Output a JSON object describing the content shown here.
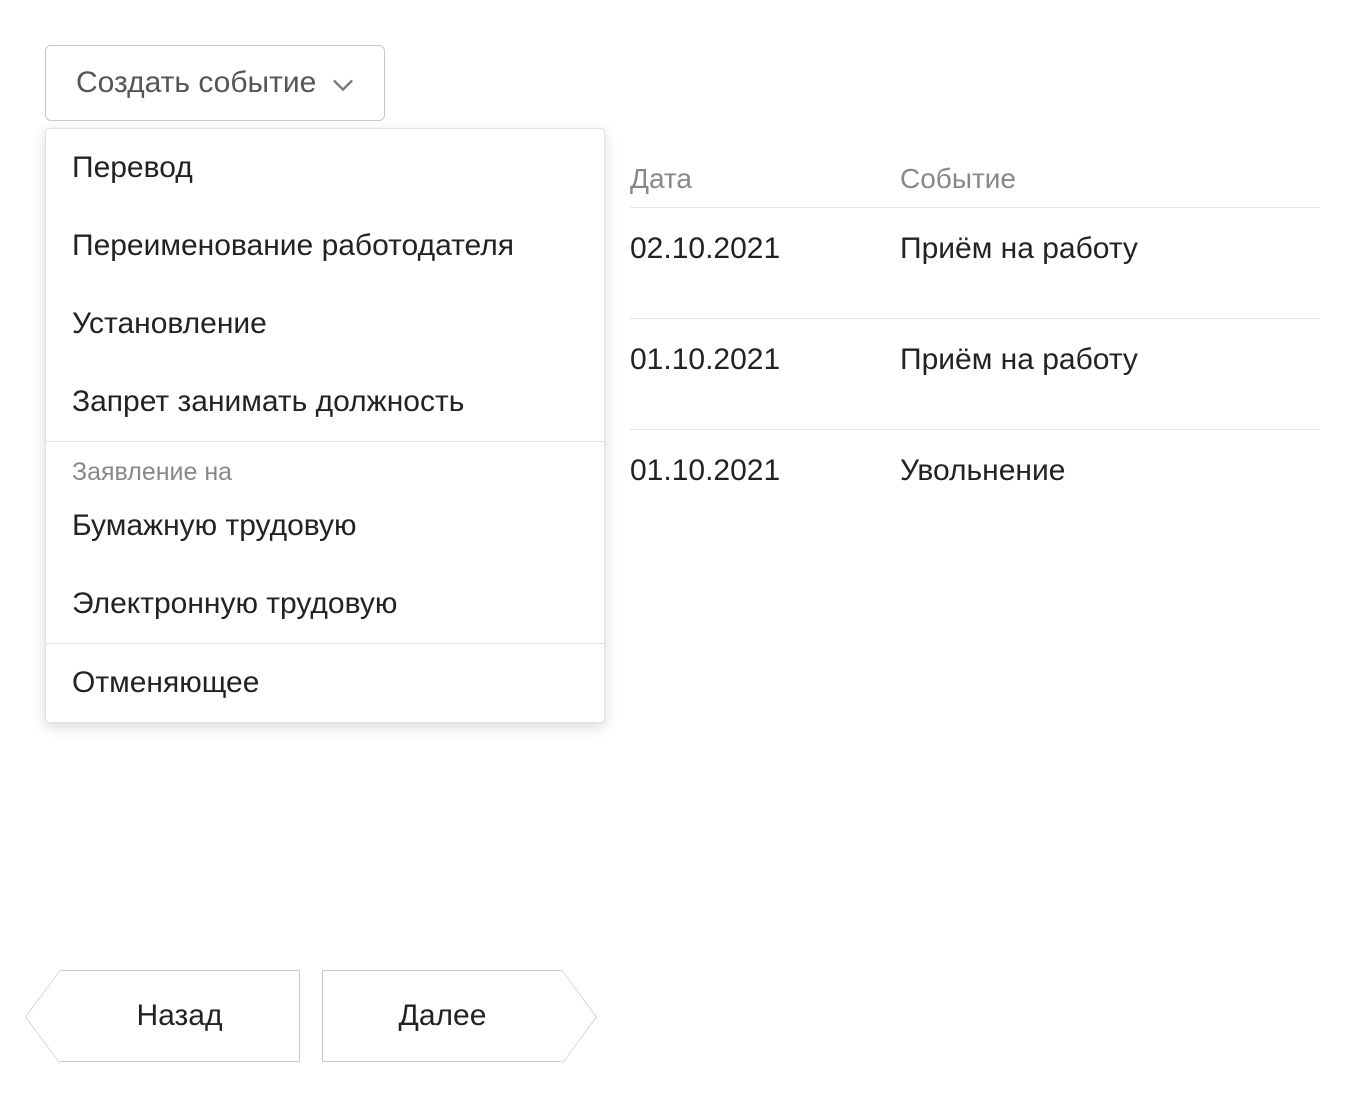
{
  "create_button": {
    "label": "Создать событие"
  },
  "dropdown": {
    "items": [
      "Перевод",
      "Переименование работодателя",
      "Установление",
      "Запрет занимать должность"
    ],
    "group_label": "Заявление на",
    "group_items": [
      "Бумажную трудовую",
      "Электронную трудовую"
    ],
    "cancel_item": "Отменяющее"
  },
  "table": {
    "header": {
      "date": "Дата",
      "event": "Событие"
    },
    "rows": [
      {
        "date": "02.10.2021",
        "event": "Приём на работу"
      },
      {
        "date": "01.10.2021",
        "event": "Приём на работу"
      },
      {
        "date": "01.10.2021",
        "event": "Увольнение"
      }
    ]
  },
  "footer": {
    "back": "Назад",
    "next": "Далее"
  }
}
